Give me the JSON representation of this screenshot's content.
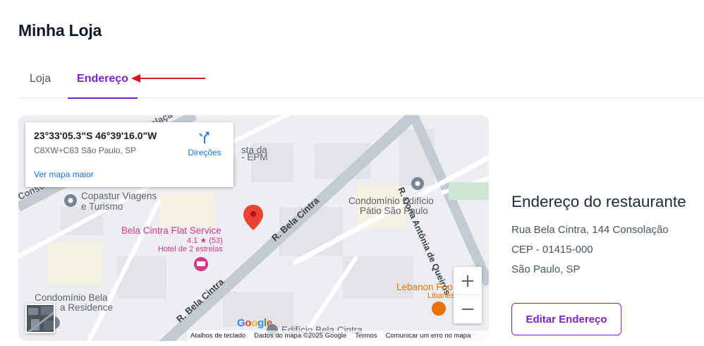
{
  "app": {
    "title": "Minha Loja"
  },
  "tabs": [
    {
      "label": "Loja",
      "active": false
    },
    {
      "label": "Endereço",
      "active": true
    }
  ],
  "colors": {
    "accent": "#7e22ce",
    "annotation_arrow": "#d71920",
    "map_link": "#1a73e8",
    "pin": "#ea4335",
    "poi_pink": "#d6378a"
  },
  "map": {
    "info_card": {
      "coordinates": "23°33'05.3\"S 46°39'16.0\"W",
      "plus_code": "C8XW+C63 São Paulo, SP",
      "directions_label": "Direções",
      "directions_icon": "directions-icon",
      "bigger_map_label": "Ver mapa maior"
    },
    "labels": {
      "poi_copastur_1": "Copastur Viagens",
      "poi_copastur_2": "e Turismo",
      "poi_flat": "Bela Cintra Flat Service",
      "poi_flat_rating": "4.1 ★ (53)",
      "poi_flat_type": "Hotel de 2 estrelas",
      "poi_condominio_patio_1": "Condomínio Edifício",
      "poi_condominio_patio_2": "Pátio São Paulo",
      "poi_condominio_bela_1": "Condomínio Bela",
      "poi_condominio_bela_2": "a Residence",
      "poi_lebanon": "Lebanon Foo",
      "poi_lebanon_sub": "Libanes",
      "poi_epm_1": "sta da",
      "poi_epm_2": "- EPM",
      "poi_edificio": "Edifício Bela Cintra",
      "street_bela_cintra_1": "R. Bela Cintra",
      "street_bela_cintra_2": "R. Bela Cintra",
      "street_dona_antonia": "R. Dona Antônia de Queirós",
      "street_consolacao": "Conso",
      "street_top": "olaçã"
    },
    "zoom_in": "+",
    "zoom_out": "−",
    "google_logo": "Google",
    "attribution": {
      "shortcuts": "Atalhos de teclado",
      "data": "Dados do mapa ©2025 Google",
      "terms": "Termos",
      "report": "Comunicar um erro no mapa"
    }
  },
  "address": {
    "title": "Endereço do restaurante",
    "line1": "Rua Bela Cintra, 144 Consolação",
    "line2": "CEP - 01415-000",
    "line3": "São Paulo, SP"
  },
  "edit_button": {
    "label": "Editar Endereço"
  }
}
